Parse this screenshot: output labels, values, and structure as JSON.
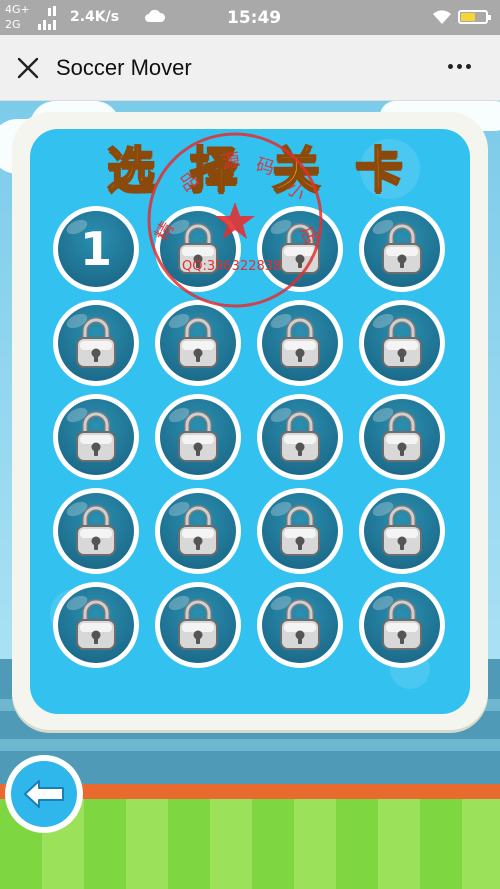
{
  "status_bar": {
    "network_top": "4G+",
    "network_bottom": "2G",
    "speed": "2.4K/s",
    "time": "15:49",
    "battery_level": 0.55
  },
  "title_bar": {
    "title": "Soccer Mover",
    "close_icon": "close-icon",
    "more_icon": "more-icon"
  },
  "game": {
    "header_chars": [
      "选",
      "择",
      "关",
      "卡"
    ],
    "levels": [
      {
        "label": "1",
        "locked": false
      },
      {
        "label": "",
        "locked": true
      },
      {
        "label": "",
        "locked": true
      },
      {
        "label": "",
        "locked": true
      },
      {
        "label": "",
        "locked": true
      },
      {
        "label": "",
        "locked": true
      },
      {
        "label": "",
        "locked": true
      },
      {
        "label": "",
        "locked": true
      },
      {
        "label": "",
        "locked": true
      },
      {
        "label": "",
        "locked": true
      },
      {
        "label": "",
        "locked": true
      },
      {
        "label": "",
        "locked": true
      },
      {
        "label": "",
        "locked": true
      },
      {
        "label": "",
        "locked": true
      },
      {
        "label": "",
        "locked": true
      },
      {
        "label": "",
        "locked": true
      },
      {
        "label": "",
        "locked": true
      },
      {
        "label": "",
        "locked": true
      },
      {
        "label": "",
        "locked": true
      },
      {
        "label": "",
        "locked": true
      }
    ],
    "back_icon": "back-arrow-icon"
  },
  "stamp": {
    "text": "精品源码小店",
    "qq": "QQ:396322838"
  },
  "colors": {
    "panel_blue": "#33c1f0",
    "level_disc": "#1e6f8f",
    "title_orange": "#f9b21e",
    "stamp_red": "#e23030"
  }
}
